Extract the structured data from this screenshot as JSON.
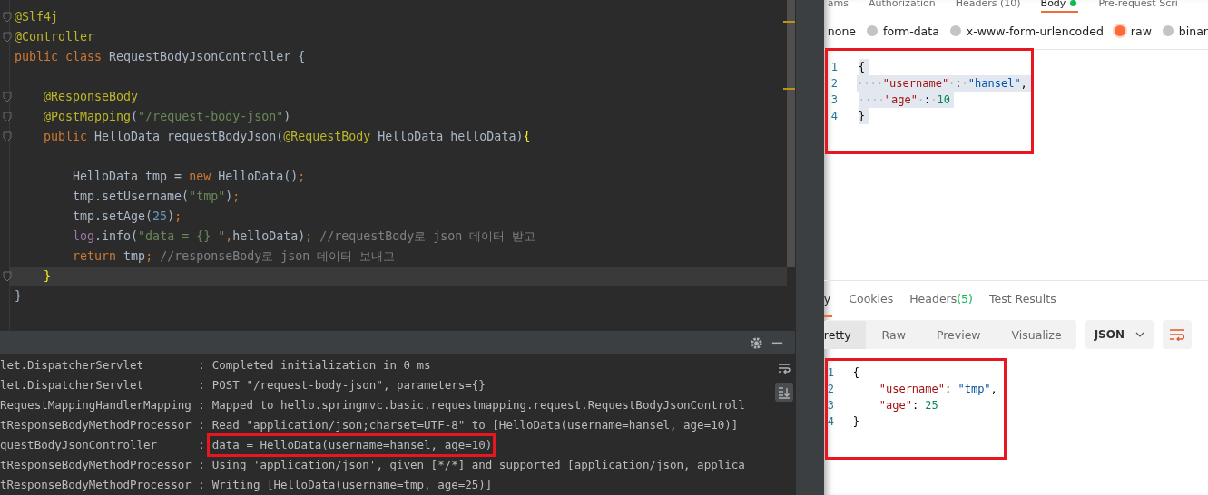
{
  "editor": {
    "lines": [
      {
        "fold": true,
        "current": false,
        "tokens": [
          {
            "kind": "annotation",
            "text": "@Slf4j"
          }
        ]
      },
      {
        "fold": true,
        "current": false,
        "tokens": [
          {
            "kind": "annotation",
            "text": "@Controller"
          }
        ]
      },
      {
        "fold": false,
        "current": false,
        "tokens": [
          {
            "kind": "keyword",
            "text": "public class "
          },
          {
            "kind": "plain",
            "text": "RequestBodyJsonController {"
          }
        ]
      },
      {
        "fold": false,
        "current": false
      },
      {
        "fold": true,
        "current": false,
        "tokens": [
          {
            "kind": "annotation",
            "text": "    @ResponseBody"
          }
        ]
      },
      {
        "fold": true,
        "current": false,
        "tokens": [
          {
            "kind": "annotation",
            "text": "    @PostMapping"
          },
          {
            "kind": "plain",
            "text": "("
          },
          {
            "kind": "string",
            "text": "\"/request-body-json\""
          },
          {
            "kind": "plain",
            "text": ")"
          }
        ]
      },
      {
        "fold": true,
        "current": false,
        "tokens": [
          {
            "kind": "keyword",
            "text": "    public "
          },
          {
            "kind": "plain",
            "text": "HelloData requestBodyJson("
          },
          {
            "kind": "annotation",
            "text": "@RequestBody"
          },
          {
            "kind": "plain",
            "text": " HelloData helloData)"
          },
          {
            "kind": "brace",
            "text": "{"
          }
        ]
      },
      {
        "fold": false,
        "current": false
      },
      {
        "fold": false,
        "current": false,
        "tokens": [
          {
            "kind": "plain",
            "text": "        HelloData tmp = "
          },
          {
            "kind": "keyword",
            "text": "new "
          },
          {
            "kind": "plain",
            "text": "HelloData()"
          },
          {
            "kind": "keyword",
            "text": ";"
          }
        ]
      },
      {
        "fold": false,
        "current": false,
        "tokens": [
          {
            "kind": "plain",
            "text": "        tmp.setUsername("
          },
          {
            "kind": "string",
            "text": "\"tmp\""
          },
          {
            "kind": "plain",
            "text": ")"
          },
          {
            "kind": "keyword",
            "text": ";"
          }
        ]
      },
      {
        "fold": false,
        "current": false,
        "tokens": [
          {
            "kind": "plain",
            "text": "        tmp.setAge("
          },
          {
            "kind": "number",
            "text": "25"
          },
          {
            "kind": "plain",
            "text": ")"
          },
          {
            "kind": "keyword",
            "text": ";"
          }
        ]
      },
      {
        "fold": false,
        "current": false,
        "tokens": [
          {
            "kind": "field",
            "text": "        log"
          },
          {
            "kind": "plain",
            "text": ".info("
          },
          {
            "kind": "string",
            "text": "\"data = {} \""
          },
          {
            "kind": "keyword",
            "text": ","
          },
          {
            "kind": "plain",
            "text": "helloData)"
          },
          {
            "kind": "keyword",
            "text": "; "
          },
          {
            "kind": "comment",
            "text": "//requestBody로 json 데이터 받고"
          }
        ]
      },
      {
        "fold": false,
        "current": false,
        "tokens": [
          {
            "kind": "keyword",
            "text": "        return "
          },
          {
            "kind": "plain",
            "text": "tmp"
          },
          {
            "kind": "keyword",
            "text": "; "
          },
          {
            "kind": "comment",
            "text": "//responseBody로 json 데이터 보내고"
          }
        ]
      },
      {
        "fold": true,
        "current": true,
        "tokens": [
          {
            "kind": "brace",
            "text": "    }"
          }
        ]
      },
      {
        "fold": false,
        "current": false,
        "tokens": [
          {
            "kind": "plain",
            "text": "}"
          }
        ]
      }
    ]
  },
  "console": {
    "rows": [
      {
        "logger": "let.DispatcherServlet        :",
        "message": "Completed initialization in 0 ms",
        "highlighted": false
      },
      {
        "logger": "let.DispatcherServlet        :",
        "message": "POST \"/request-body-json\", parameters={}",
        "highlighted": false
      },
      {
        "logger": "RequestMappingHandlerMapping :",
        "message": "Mapped to hello.springmvc.basic.requestmapping.request.RequestBodyJsonControll",
        "highlighted": false
      },
      {
        "logger": "tResponseBodyMethodProcessor :",
        "message": "Read \"application/json;charset=UTF-8\" to [HelloData(username=hansel, age=10)]",
        "highlighted": false
      },
      {
        "logger": "questBodyJsonController      :",
        "message": "data = HelloData(username=hansel, age=10)",
        "highlighted": true
      },
      {
        "logger": "tResponseBodyMethodProcessor :",
        "message": "Using 'application/json', given [*/*] and supported [application/json, applica",
        "highlighted": false
      },
      {
        "logger": "tResponseBodyMethodProcessor :",
        "message": "Writing [HelloData(username=tmp, age=25)]",
        "highlighted": false
      }
    ]
  },
  "request": {
    "tabs": [
      {
        "label": "ams",
        "selected": false
      },
      {
        "label": "Authorization",
        "selected": false
      },
      {
        "label": "Headers (10)",
        "selected": false
      },
      {
        "label": "Body",
        "selected": true
      },
      {
        "label": "Pre-request Scri",
        "selected": false
      }
    ],
    "body_types": [
      {
        "kind": "label",
        "label": "none",
        "selected": false
      },
      {
        "kind": "radio",
        "label": "form-data",
        "selected": false
      },
      {
        "kind": "radio",
        "label": "x-www-form-urlencoded",
        "selected": false
      },
      {
        "kind": "radio",
        "label": "raw",
        "selected": true
      },
      {
        "kind": "radio",
        "label": "binar",
        "selected": false
      }
    ],
    "highlighted": true,
    "lines": [
      {
        "number": "1",
        "tokens": [
          {
            "kind": "punct",
            "text": "{"
          }
        ]
      },
      {
        "number": "2",
        "tokens": [
          {
            "kind": "ws",
            "text": "····"
          },
          {
            "kind": "key",
            "text": "\"username\""
          },
          {
            "kind": "ws",
            "text": "·"
          },
          {
            "kind": "punct",
            "text": ":"
          },
          {
            "kind": "ws",
            "text": "·"
          },
          {
            "kind": "string",
            "text": "\"hansel\""
          },
          {
            "kind": "punct",
            "text": ","
          }
        ]
      },
      {
        "number": "3",
        "tokens": [
          {
            "kind": "ws",
            "text": "····"
          },
          {
            "kind": "key",
            "text": "\"age\""
          },
          {
            "kind": "ws",
            "text": "·"
          },
          {
            "kind": "punct",
            "text": ":"
          },
          {
            "kind": "ws",
            "text": "·"
          },
          {
            "kind": "number",
            "text": "10"
          }
        ]
      },
      {
        "number": "4",
        "tokens": [
          {
            "kind": "punct",
            "text": "}"
          }
        ]
      }
    ]
  },
  "response": {
    "tabs": [
      {
        "label": "y",
        "selected": true
      },
      {
        "label": "Cookies",
        "selected": false
      },
      {
        "label": "Headers",
        "count": "(5)",
        "selected": false
      },
      {
        "label": "Test Results",
        "selected": false
      }
    ],
    "views": [
      {
        "label": "retty",
        "selected": true
      },
      {
        "label": "Raw",
        "selected": false
      },
      {
        "label": "Preview",
        "selected": false
      },
      {
        "label": "Visualize",
        "selected": false
      }
    ],
    "format": "JSON",
    "highlighted": true,
    "lines": [
      {
        "number": "1",
        "tokens": [
          {
            "kind": "punct",
            "text": "{"
          }
        ]
      },
      {
        "number": "2",
        "tokens": [
          {
            "kind": "key",
            "text": "    \"username\""
          },
          {
            "kind": "punct",
            "text": ": "
          },
          {
            "kind": "string",
            "text": "\"tmp\""
          },
          {
            "kind": "punct",
            "text": ","
          }
        ]
      },
      {
        "number": "3",
        "tokens": [
          {
            "kind": "key",
            "text": "    \"age\""
          },
          {
            "kind": "punct",
            "text": ": "
          },
          {
            "kind": "number",
            "text": "25"
          }
        ]
      },
      {
        "number": "4",
        "tokens": [
          {
            "kind": "punct",
            "text": "}"
          }
        ]
      }
    ]
  }
}
